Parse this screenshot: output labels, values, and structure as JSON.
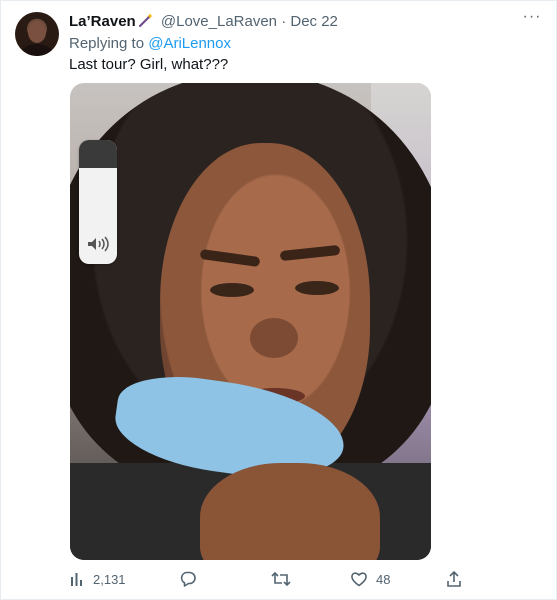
{
  "tweet": {
    "author_name": "La’Raven",
    "author_handle": "@Love_LaRaven",
    "separator": "·",
    "date": "Dec 22",
    "replying_to_prefix": "Replying to",
    "replying_to_handle": "@AriLennox",
    "text": "Last tour? Girl, what???",
    "more_glyph": "···"
  },
  "metrics": {
    "views": "2,131",
    "likes": "48"
  },
  "colors": {
    "accent": "#1d9bf0",
    "muted": "#536471",
    "text": "#0f1419"
  },
  "icons": {
    "badge": "magic-wand-icon",
    "views": "bar-chart-icon",
    "reply": "speech-bubble-icon",
    "retweet": "retweet-icon",
    "like": "heart-icon",
    "share": "share-upload-icon",
    "volume": "speaker-icon"
  }
}
